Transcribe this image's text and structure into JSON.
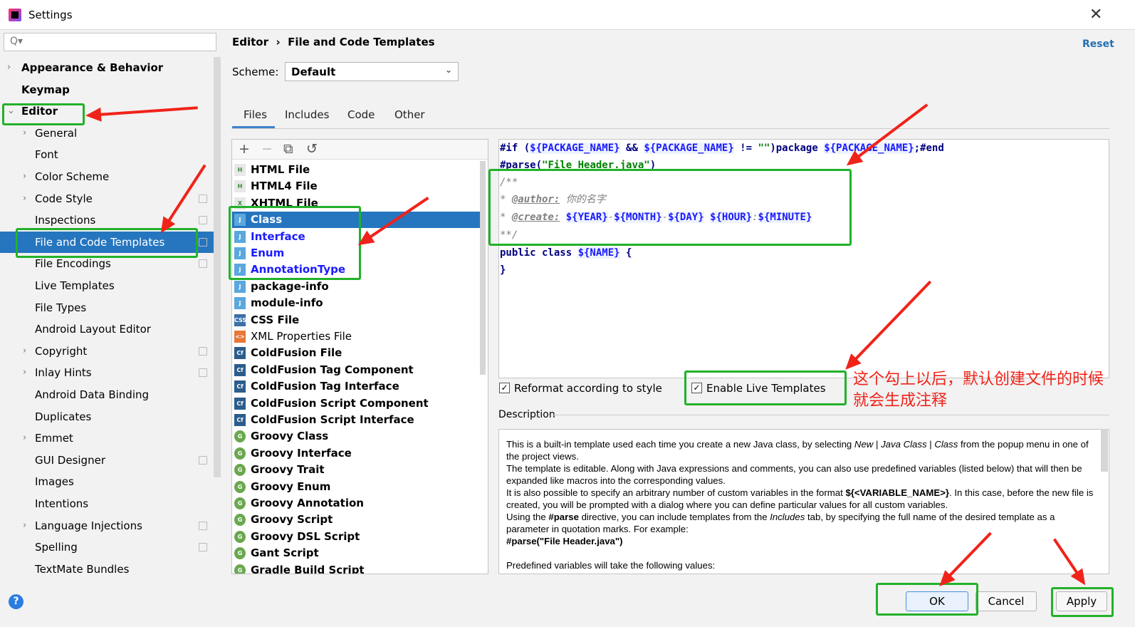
{
  "window": {
    "title": "Settings",
    "close": "✕"
  },
  "sidebar": {
    "search_placeholder": "Q▾",
    "items": [
      {
        "label": "Appearance & Behavior",
        "bold": true,
        "chev": "›"
      },
      {
        "label": "Keymap",
        "bold": true
      },
      {
        "label": "Editor",
        "bold": true,
        "chev": "⌄"
      },
      {
        "label": "General",
        "chev": "›"
      },
      {
        "label": "Font"
      },
      {
        "label": "Color Scheme",
        "chev": "›"
      },
      {
        "label": "Code Style",
        "chev": "›",
        "cfg": true
      },
      {
        "label": "Inspections",
        "cfg": true
      },
      {
        "label": "File and Code Templates",
        "cfg": true,
        "selected": true
      },
      {
        "label": "File Encodings",
        "cfg": true
      },
      {
        "label": "Live Templates"
      },
      {
        "label": "File Types"
      },
      {
        "label": "Android Layout Editor"
      },
      {
        "label": "Copyright",
        "chev": "›",
        "cfg": true
      },
      {
        "label": "Inlay Hints",
        "chev": "›",
        "cfg": true
      },
      {
        "label": "Android Data Binding"
      },
      {
        "label": "Duplicates"
      },
      {
        "label": "Emmet",
        "chev": "›"
      },
      {
        "label": "GUI Designer",
        "cfg": true
      },
      {
        "label": "Images"
      },
      {
        "label": "Intentions"
      },
      {
        "label": "Language Injections",
        "chev": "›",
        "cfg": true
      },
      {
        "label": "Spelling",
        "cfg": true
      },
      {
        "label": "TextMate Bundles"
      }
    ]
  },
  "header": {
    "breadcrumb_parent": "Editor",
    "breadcrumb_sep": "›",
    "breadcrumb_current": "File and Code Templates",
    "reset": "Reset",
    "scheme_label": "Scheme:",
    "scheme_value": "Default"
  },
  "tabs": [
    {
      "label": "Files",
      "active": true
    },
    {
      "label": "Includes"
    },
    {
      "label": "Code"
    },
    {
      "label": "Other"
    }
  ],
  "toolbar": {
    "add": "+",
    "remove": "−",
    "copy": "⧉",
    "reset": "↺"
  },
  "templates": [
    {
      "label": "HTML File",
      "icon": "H",
      "color": "#e8e8e8"
    },
    {
      "label": "HTML4 File",
      "icon": "H",
      "color": "#e8e8e8"
    },
    {
      "label": "XHTML File",
      "icon": "X",
      "color": "#e8e8e8"
    },
    {
      "label": "Class",
      "icon": "J",
      "color": "#5aa8de",
      "selected": true
    },
    {
      "label": "Interface",
      "icon": "J",
      "color": "#5aa8de",
      "blue": true
    },
    {
      "label": "Enum",
      "icon": "J",
      "color": "#5aa8de",
      "blue": true
    },
    {
      "label": "AnnotationType",
      "icon": "J",
      "color": "#5aa8de",
      "blue": true
    },
    {
      "label": "package-info",
      "icon": "J",
      "color": "#5aa8de"
    },
    {
      "label": "module-info",
      "icon": "J",
      "color": "#5aa8de"
    },
    {
      "label": "CSS File",
      "icon": "CSS",
      "color": "#3d6fa8"
    },
    {
      "label": "XML Properties File",
      "icon": "<>",
      "color": "#e8773a",
      "normal": true
    },
    {
      "label": "ColdFusion File",
      "icon": "Cf",
      "color": "#2b5d8c"
    },
    {
      "label": "ColdFusion Tag Component",
      "icon": "Cf",
      "color": "#2b5d8c"
    },
    {
      "label": "ColdFusion Tag Interface",
      "icon": "Cf",
      "color": "#2b5d8c"
    },
    {
      "label": "ColdFusion Script Component",
      "icon": "Cf",
      "color": "#2b5d8c"
    },
    {
      "label": "ColdFusion Script Interface",
      "icon": "Cf",
      "color": "#2b5d8c"
    },
    {
      "label": "Groovy Class",
      "icon": "G",
      "color": "#6aa84f"
    },
    {
      "label": "Groovy Interface",
      "icon": "G",
      "color": "#6aa84f"
    },
    {
      "label": "Groovy Trait",
      "icon": "G",
      "color": "#6aa84f"
    },
    {
      "label": "Groovy Enum",
      "icon": "G",
      "color": "#6aa84f"
    },
    {
      "label": "Groovy Annotation",
      "icon": "G",
      "color": "#6aa84f"
    },
    {
      "label": "Groovy Script",
      "icon": "G",
      "color": "#6aa84f"
    },
    {
      "label": "Groovy DSL Script",
      "icon": "G",
      "color": "#6aa84f"
    },
    {
      "label": "Gant Script",
      "icon": "G",
      "color": "#6aa84f"
    },
    {
      "label": "Gradle Build Script",
      "icon": "G",
      "color": "#6aa84f"
    }
  ],
  "editor": {
    "lines": [
      "#if (${PACKAGE_NAME} && ${PACKAGE_NAME} != \"\")package ${PACKAGE_NAME};#end",
      "#parse(\"File Header.java\")",
      "/**",
      "* @author: 你的名字",
      "* @create: ${YEAR}-${MONTH}-${DAY} ${HOUR}:${MINUTE}",
      "**/",
      "public class ${NAME} {",
      "}"
    ]
  },
  "options": {
    "reformat": "Reformat according to style",
    "reformat_checked": true,
    "live": "Enable Live Templates",
    "live_checked": true
  },
  "description": {
    "label": "Description",
    "html": "This is a built-in template used each time you create a new Java class, by selecting <i>New</i> | <i>Java Class</i> | <i>Class</i> from the popup menu in one of the project views.<br>The template is editable. Along with Java expressions and comments, you can also use predefined variables (listed below) that will then be expanded like macros into the corresponding values.<br>It is also possible to specify an arbitrary number of custom variables in the format <b>${&lt;VARIABLE_NAME&gt;}</b>. In this case, before the new file is created, you will be prompted with a dialog where you can define particular values for all custom variables.<br>Using the <b>#parse</b> directive, you can include templates from the <i>Includes</i> tab, by specifying the full name of the desired template as a parameter in quotation marks. For example:<br><b>#parse(\"File Header.java\")</b><br><br>Predefined variables will take the following values:"
  },
  "footer": {
    "help": "?",
    "ok": "OK",
    "cancel": "Cancel",
    "apply": "Apply"
  },
  "annotation": {
    "note": "这个勾上以后，默认创建文件的时候就会生成注释",
    "color": "#f0231a",
    "box_color": "#22b12a"
  }
}
